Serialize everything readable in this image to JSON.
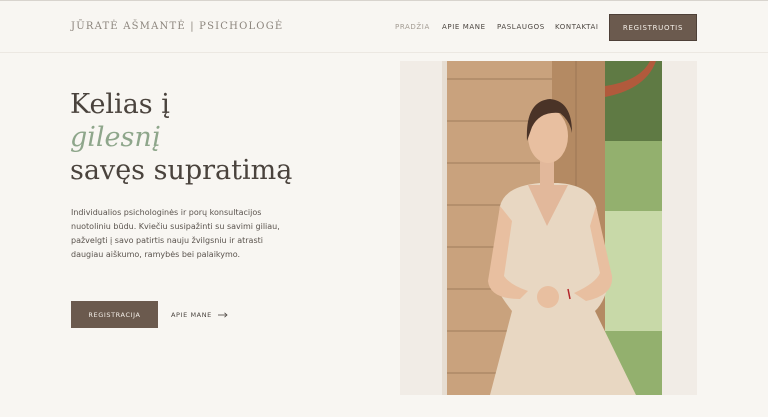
{
  "header": {
    "brand": "JŪRATĖ AŠMANTĖ | PSICHOLOGĖ",
    "nav": [
      "PRADŽIA",
      "APIE MANE",
      "PASLAUGOS",
      "KONTAKTAI"
    ],
    "active_index": 0,
    "cta": "REGISTRUOTIS"
  },
  "hero": {
    "title_line1": "Kelias į",
    "title_accent": "gilesnį",
    "title_line3": "savęs supratimą",
    "description": "Individualios psichologinės ir porų konsultacijos nuotoliniu būdu. Kviečiu susipažinti su savimi giliau, pažvelgti į savo patirtis nauju žvilgsniu ir atrasti daugiau aiškumo, ramybės bei palaikymo.",
    "primary_button": "REGISTRACIJA",
    "secondary_link": "APIE MANE",
    "secondary_icon": "arrow-right-icon"
  },
  "colors": {
    "background": "#f8f6f2",
    "button": "#6b5a4e",
    "accent": "#8ea68b",
    "text": "#4a433d"
  }
}
